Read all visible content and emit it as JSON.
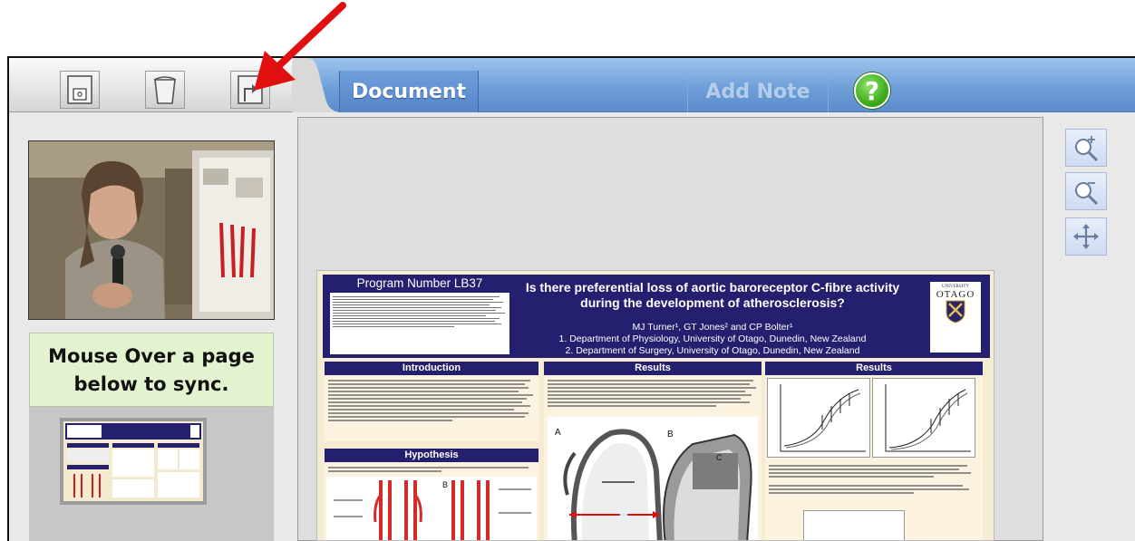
{
  "toolbar": {
    "save_icon": "floppy-disk-icon",
    "trash_icon": "trash-can-icon",
    "export_icon": "export-arrow-icon",
    "document_tab": "Document",
    "add_note_tab": "Add Note",
    "help_label": "?"
  },
  "left_panel": {
    "sync_message": "Mouse Over a page below to sync."
  },
  "zoom": {
    "zoom_in_icon": "zoom-in-icon",
    "zoom_out_icon": "zoom-out-icon",
    "pan_icon": "move-arrows-icon"
  },
  "poster": {
    "program_number": "Program Number LB37",
    "title": "Is there preferential loss of aortic baroreceptor C-fibre activity during the development of atherosclerosis?",
    "authors": "MJ Turner¹, GT Jones² and CP Bolter¹",
    "affiliation_1": "1.  Department of Physiology, University of Otago, Dunedin, New Zealand",
    "affiliation_2": "2. Department of Surgery, University of Otago, Dunedin, New Zealand",
    "logo_university": "UNIVERSITY",
    "logo_name": "OTAGO",
    "section_introduction": "Introduction",
    "section_results_1": "Results",
    "section_results_2": "Results",
    "section_hypothesis": "Hypothesis",
    "figure_label_a": "A",
    "figure_label_b": "B",
    "figure_label_c": "C"
  },
  "colors": {
    "toolbar_blue": "#6f9fd9",
    "poster_navy": "#241f6e",
    "sync_green": "#e4f3cf",
    "annotation_red": "#e01010"
  }
}
